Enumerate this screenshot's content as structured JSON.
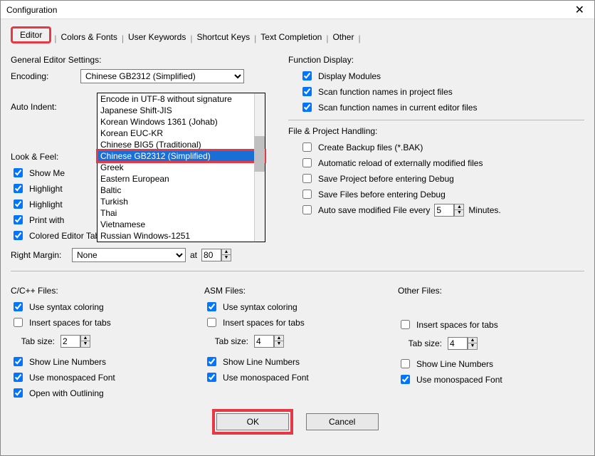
{
  "title": "Configuration",
  "tabs": [
    "Editor",
    "Colors & Fonts",
    "User Keywords",
    "Shortcut Keys",
    "Text Completion",
    "Other"
  ],
  "left": {
    "general_label": "General Editor Settings:",
    "encoding_label": "Encoding:",
    "encoding_value": "Chinese GB2312 (Simplified)",
    "auto_indent_label": "Auto Indent:",
    "encoding_options": [
      "Encode in UTF-8 without signature",
      "Japanese Shift-JIS",
      "Korean Windows 1361 (Johab)",
      "Korean EUC-KR",
      "Chinese BIG5 (Traditional)",
      "Chinese GB2312 (Simplified)",
      "Greek",
      "Eastern European",
      "Baltic",
      "Turkish",
      "Thai",
      "Vietnamese",
      "Russian Windows-1251"
    ],
    "look_feel_label": "Look & Feel:",
    "show_message": "Show Me",
    "highlight1": "Highlight",
    "highlight2": "Highlight",
    "print_with": "Print with",
    "colored_tabs": "Colored Editor Tabs",
    "right_margin_label": "Right Margin:",
    "right_margin_value": "None",
    "at_label": "at",
    "at_value": "80"
  },
  "right": {
    "func_label": "Function Display:",
    "display_modules": "Display Modules",
    "scan_project": "Scan function names in project files",
    "scan_editor": "Scan function names in current editor files",
    "file_proj_label": "File & Project Handling:",
    "create_backup": "Create Backup files (*.BAK)",
    "auto_reload": "Automatic reload of externally modified files",
    "save_project": "Save Project before entering Debug",
    "save_files": "Save Files before entering Debug",
    "auto_save": "Auto save modified File every",
    "auto_save_value": "5",
    "auto_save_unit": "Minutes."
  },
  "file_cols": {
    "cc": {
      "title": "C/C++ Files:",
      "syntax": "Use syntax coloring",
      "spaces": "Insert spaces for tabs",
      "tab_label": "Tab size:",
      "tab_value": "2",
      "line_numbers": "Show Line Numbers",
      "monospaced": "Use monospaced Font",
      "outlining": "Open with Outlining"
    },
    "asm": {
      "title": "ASM Files:",
      "syntax": "Use syntax coloring",
      "spaces": "Insert spaces for tabs",
      "tab_label": "Tab size:",
      "tab_value": "4",
      "line_numbers": "Show Line Numbers",
      "monospaced": "Use monospaced Font"
    },
    "other": {
      "title": "Other Files:",
      "spaces": "Insert spaces for tabs",
      "tab_label": "Tab size:",
      "tab_value": "4",
      "line_numbers": "Show Line Numbers",
      "monospaced": "Use monospaced Font"
    }
  },
  "buttons": {
    "ok": "OK",
    "cancel": "Cancel"
  }
}
